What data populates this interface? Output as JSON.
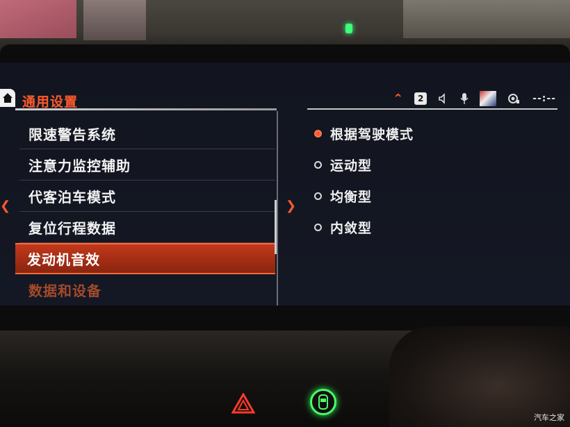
{
  "header": {
    "title": "通用设置",
    "status": {
      "badge_number": "2",
      "clock": "--:--"
    }
  },
  "menu": {
    "items": [
      {
        "label": "限速警告系统"
      },
      {
        "label": "注意力监控辅助"
      },
      {
        "label": "代客泊车模式"
      },
      {
        "label": "复位行程数据"
      },
      {
        "label": "发动机音效"
      },
      {
        "label": "数据和设备"
      }
    ],
    "active_index": 4
  },
  "options": {
    "items": [
      {
        "label": "根据驾驶模式",
        "selected": true
      },
      {
        "label": "运动型",
        "selected": false
      },
      {
        "label": "均衡型",
        "selected": false
      },
      {
        "label": "内敛型",
        "selected": false
      }
    ]
  },
  "watermark": "汽车之家",
  "colors": {
    "accent": "#ff5a2c",
    "highlight": "#b3331a",
    "hazard_light": "#ff3a2a",
    "button_glow": "#4cff6a"
  }
}
